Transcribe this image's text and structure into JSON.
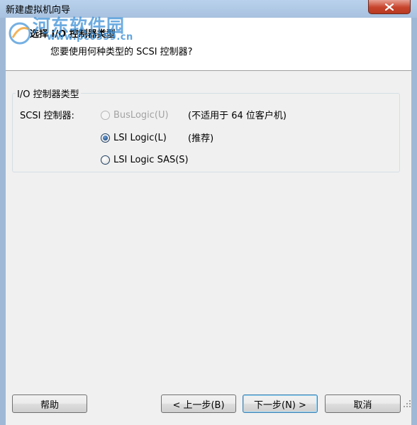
{
  "window": {
    "title": "新建虚拟机向导"
  },
  "watermark": {
    "text": "河东软件园",
    "sub": "www.pc0359.cn"
  },
  "header": {
    "title": "选择 I/O 控制器类型",
    "subtitle": "您要使用何种类型的 SCSI 控制器?"
  },
  "group": {
    "legend": "I/O 控制器类型",
    "field_label": "SCSI 控制器:",
    "options": [
      {
        "label": "BusLogic(U)",
        "note": "(不适用于 64 位客户机)",
        "checked": false,
        "enabled": false
      },
      {
        "label": "LSI Logic(L)",
        "note": "(推荐)",
        "checked": true,
        "enabled": true
      },
      {
        "label": "LSI Logic SAS(S)",
        "note": "",
        "checked": false,
        "enabled": true
      }
    ]
  },
  "buttons": {
    "help": "帮助",
    "back": "< 上一步(B)",
    "next": "下一步(N) >",
    "cancel": "取消"
  },
  "colors": {
    "titlebar": "#a7c1df",
    "dialog_bg": "#f0f0f0",
    "close_button": "#c7432c",
    "watermark": "#3b8fd6"
  }
}
